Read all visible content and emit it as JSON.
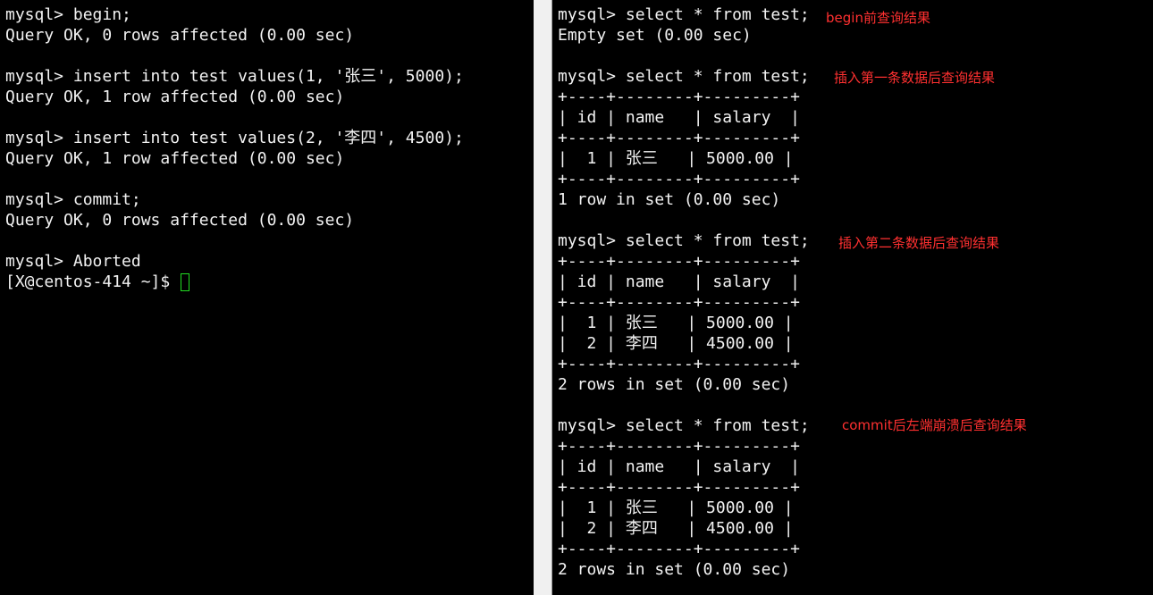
{
  "left_terminal": {
    "lines": [
      "mysql> begin;",
      "Query OK, 0 rows affected (0.00 sec)",
      "",
      "mysql> insert into test values(1, '张三', 5000);",
      "Query OK, 1 row affected (0.00 sec)",
      "",
      "mysql> insert into test values(2, '李四', 4500);",
      "Query OK, 1 row affected (0.00 sec)",
      "",
      "mysql> commit;",
      "Query OK, 0 rows affected (0.00 sec)",
      "",
      "mysql> Aborted",
      "[X@centos-414 ~]$ "
    ]
  },
  "right_terminal": {
    "lines": [
      "mysql> select * from test;",
      "Empty set (0.00 sec)",
      "",
      "mysql> select * from test;",
      "+----+--------+---------+",
      "| id | name   | salary  |",
      "+----+--------+---------+",
      "|  1 | 张三   | 5000.00 |",
      "+----+--------+---------+",
      "1 row in set (0.00 sec)",
      "",
      "mysql> select * from test;",
      "+----+--------+---------+",
      "| id | name   | salary  |",
      "+----+--------+---------+",
      "|  1 | 张三   | 5000.00 |",
      "|  2 | 李四   | 4500.00 |",
      "+----+--------+---------+",
      "2 rows in set (0.00 sec)",
      "",
      "mysql> select * from test;",
      "+----+--------+---------+",
      "| id | name   | salary  |",
      "+----+--------+---------+",
      "|  1 | 张三   | 5000.00 |",
      "|  2 | 李四   | 4500.00 |",
      "+----+--------+---------+",
      "2 rows in set (0.00 sec)"
    ]
  },
  "annotations": [
    "begin前查询结果",
    "插入第一条数据后查询结果",
    "插入第二条数据后查询结果",
    "commit后左端崩溃后查询结果"
  ],
  "colors": {
    "terminal_bg": "#000000",
    "terminal_fg": "#f2f2f2",
    "annotation": "#ff3030",
    "cursor": "#22dd22"
  }
}
